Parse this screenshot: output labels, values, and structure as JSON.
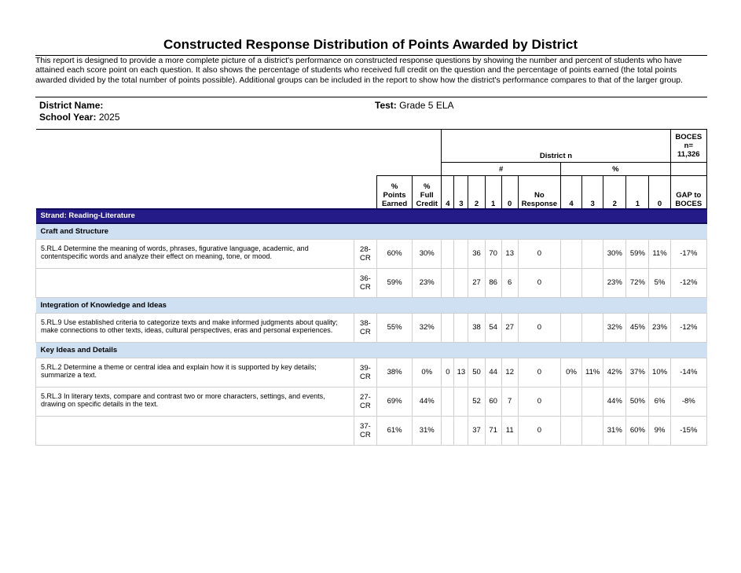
{
  "report": {
    "title": "Constructed Response Distribution of Points Awarded by District",
    "description": "This report is designed to provide a more complete picture of a district's performance on constructed response questions by showing the number and percent of students who have attained each score point on each question. It also shows the percentage of students who received full credit on the question and the percentage of points earned (the total points awarded divided by the total number of points possible). Additional groups can be included in the report to show how the district's performance compares to that of the larger group.",
    "district_label": "District Name:",
    "district_value": "",
    "school_year_label": "School Year:",
    "school_year_value": "2025",
    "test_label": "Test:",
    "test_value": "Grade 5 ELA"
  },
  "table_header": {
    "district_n": "District n",
    "boces_label": "BOCES",
    "boces_n_label": "n=",
    "boces_n": "11,326",
    "count_symbol": "#",
    "percent_symbol": "%",
    "points_earned_1": "%",
    "points_earned_2": "Points",
    "points_earned_3": "Earned",
    "full_credit_1": "%",
    "full_credit_2": "Full",
    "full_credit_3": "Credit",
    "no_response_1": "No",
    "no_response_2": "Response",
    "gap_1": "GAP to",
    "gap_2": "BOCES",
    "score_cols": [
      "4",
      "3",
      "2",
      "1",
      "0"
    ]
  },
  "strand": "Strand: Reading-Literature",
  "sections": [
    {
      "name": "Craft and Structure",
      "standards": [
        {
          "text": "5.RL.4 Determine the meaning of words, phrases, figurative language, academic, and contentspecific words and analyze their effect on meaning, tone, or mood.",
          "items": [
            {
              "q1": "28-",
              "q2": "CR",
              "pe": "60%",
              "fc": "30%",
              "n4": "",
              "n3": "",
              "n2": "36",
              "n1": "70",
              "n0": "13",
              "nr": "0",
              "p4": "",
              "p3": "",
              "p2": "30%",
              "p1": "59%",
              "p0": "11%",
              "gap": "-17%"
            },
            {
              "q1": "36-",
              "q2": "CR",
              "pe": "59%",
              "fc": "23%",
              "n4": "",
              "n3": "",
              "n2": "27",
              "n1": "86",
              "n0": "6",
              "nr": "0",
              "p4": "",
              "p3": "",
              "p2": "23%",
              "p1": "72%",
              "p0": "5%",
              "gap": "-12%"
            }
          ]
        }
      ]
    },
    {
      "name": "Integration of Knowledge and Ideas",
      "standards": [
        {
          "text": "5.RL.9 Use established criteria to categorize texts and make informed judgments about quality; make connections to other texts, ideas, cultural perspectives, eras and personal experiences.",
          "items": [
            {
              "q1": "38-",
              "q2": "CR",
              "pe": "55%",
              "fc": "32%",
              "n4": "",
              "n3": "",
              "n2": "38",
              "n1": "54",
              "n0": "27",
              "nr": "0",
              "p4": "",
              "p3": "",
              "p2": "32%",
              "p1": "45%",
              "p0": "23%",
              "gap": "-12%"
            }
          ]
        }
      ]
    },
    {
      "name": "Key Ideas and Details",
      "standards": [
        {
          "text": "5.RL.2 Determine a theme or central idea and explain how it is supported by key details; summarize a text.",
          "items": [
            {
              "q1": "39-",
              "q2": "CR",
              "pe": "38%",
              "fc": "0%",
              "n4": "0",
              "n3": "13",
              "n2": "50",
              "n1": "44",
              "n0": "12",
              "nr": "0",
              "p4": "0%",
              "p3": "11%",
              "p2": "42%",
              "p1": "37%",
              "p0": "10%",
              "gap": "-14%"
            }
          ]
        },
        {
          "text": "5.RL.3 In literary texts, compare and contrast two or more characters, settings, and events, drawing on specific details in the text.",
          "items": [
            {
              "q1": "27-",
              "q2": "CR",
              "pe": "69%",
              "fc": "44%",
              "n4": "",
              "n3": "",
              "n2": "52",
              "n1": "60",
              "n0": "7",
              "nr": "0",
              "p4": "",
              "p3": "",
              "p2": "44%",
              "p1": "50%",
              "p0": "6%",
              "gap": "-8%"
            },
            {
              "q1": "37-",
              "q2": "CR",
              "pe": "61%",
              "fc": "31%",
              "n4": "",
              "n3": "",
              "n2": "37",
              "n1": "71",
              "n0": "11",
              "nr": "0",
              "p4": "",
              "p3": "",
              "p2": "31%",
              "p1": "60%",
              "p0": "9%",
              "gap": "-15%"
            }
          ]
        }
      ]
    }
  ],
  "colors": {
    "strand_bg": "#241b89",
    "subheader_bg": "#cfe0f3",
    "border_light": "#d0d0d0"
  }
}
